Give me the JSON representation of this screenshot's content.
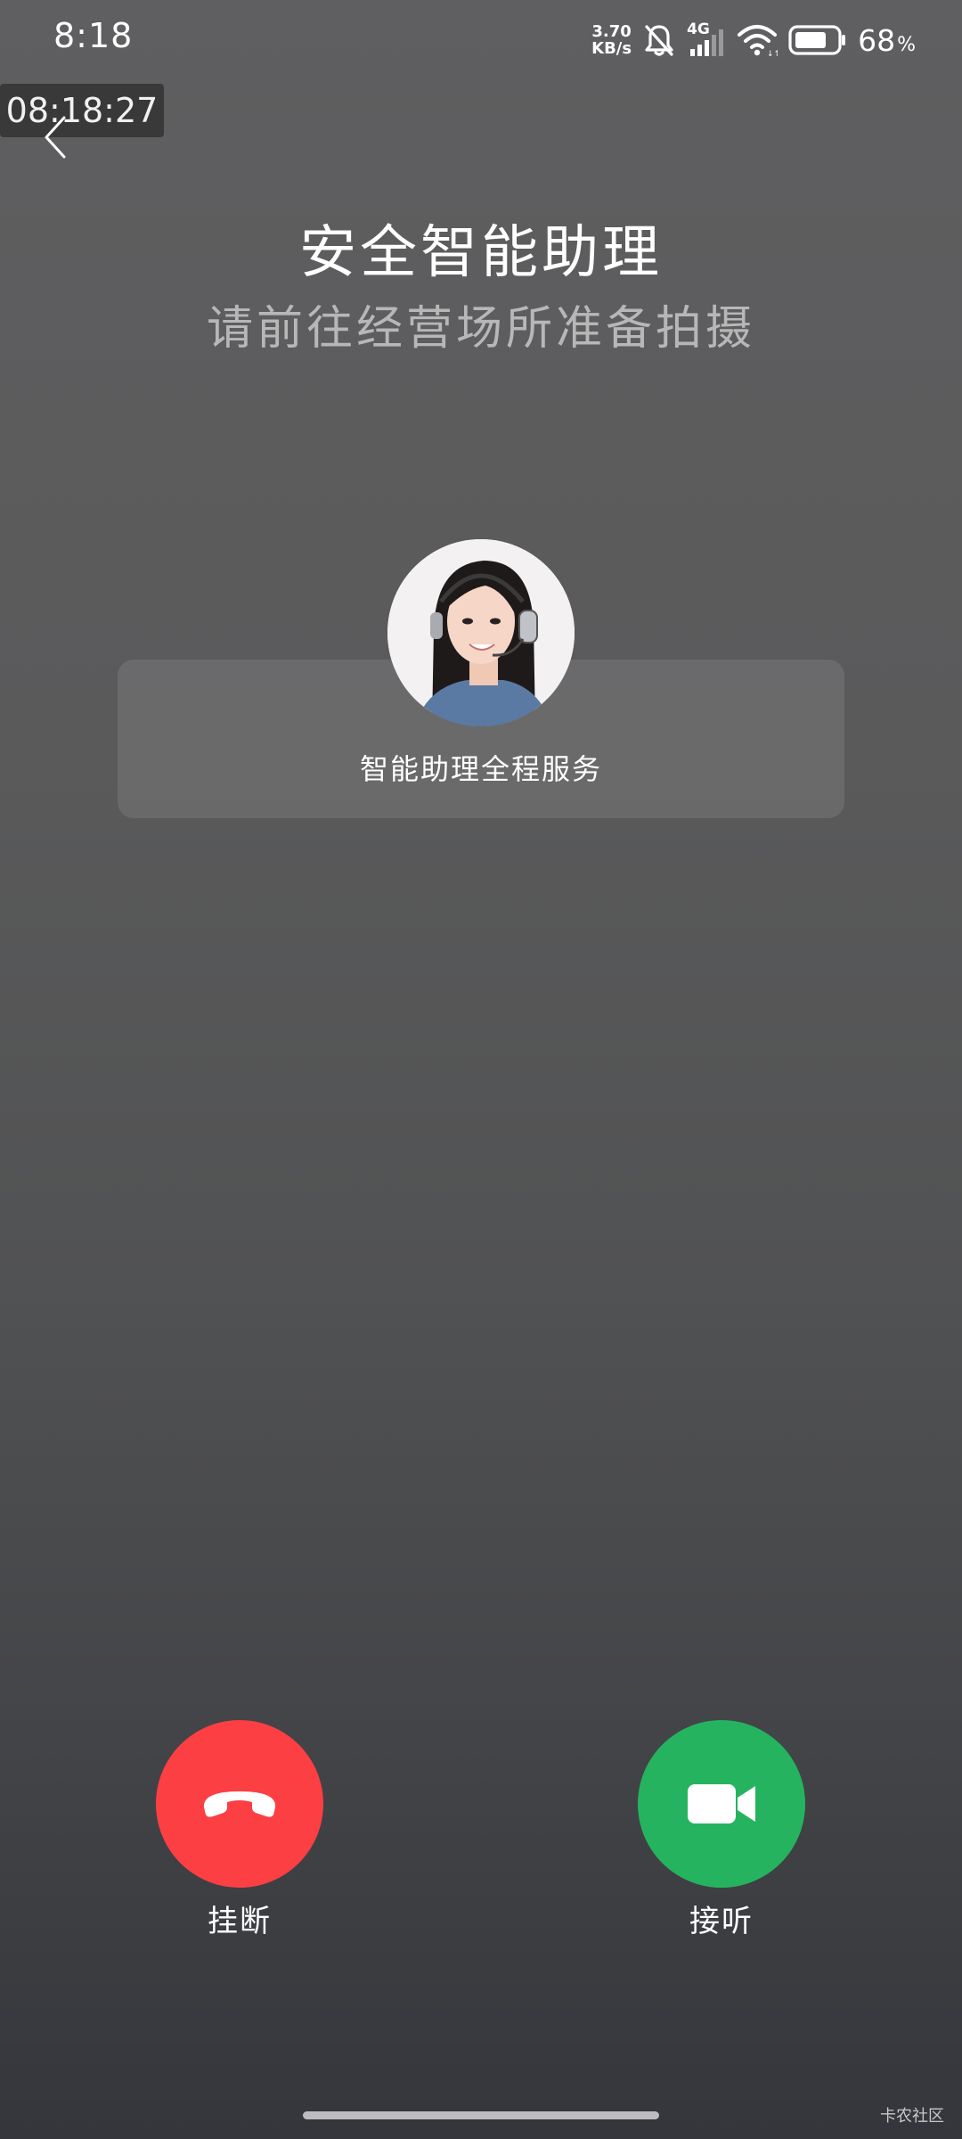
{
  "status_bar": {
    "time": "8:18",
    "net_speed_value": "3.70",
    "net_speed_unit": "KB/s",
    "network_type": "4G",
    "battery_percent": "68",
    "battery_percent_sign": "%",
    "icons": [
      "silent-bell-icon",
      "cellular-signal-icon",
      "wifi-icon",
      "battery-icon"
    ]
  },
  "overlay": {
    "timestamp": "08:18:27"
  },
  "header": {
    "title": "安全智能助理",
    "subtitle": "请前往经营场所准备拍摄"
  },
  "agent": {
    "label": "智能助理全程服务",
    "avatar_icon": "agent-avatar"
  },
  "actions": {
    "decline_label": "挂断",
    "accept_label": "接听",
    "decline_color": "#fb3f43",
    "accept_color": "#25b35f"
  },
  "watermark": "卡农社区"
}
